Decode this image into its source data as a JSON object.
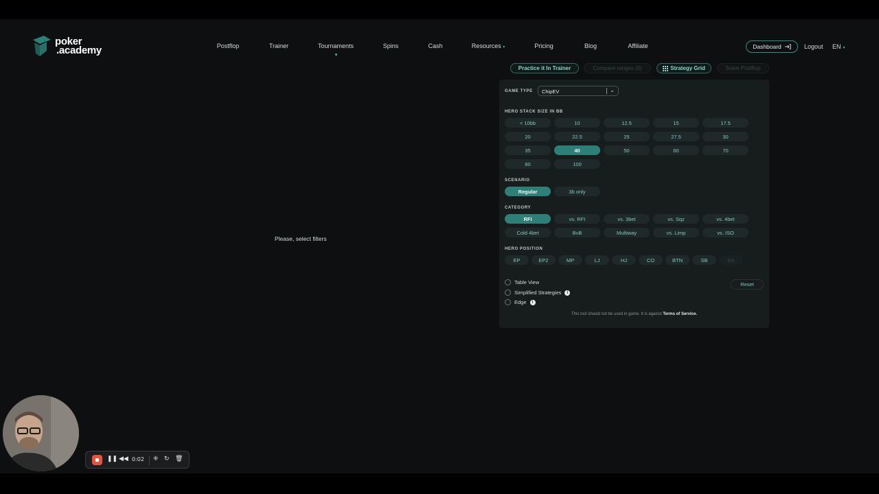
{
  "logo": {
    "line1": "poker",
    "line2": ".academy"
  },
  "nav": {
    "items": [
      {
        "label": "Postflop"
      },
      {
        "label": "Trainer"
      },
      {
        "label": "Tournaments"
      },
      {
        "label": "Spins"
      },
      {
        "label": "Cash"
      },
      {
        "label": "Resources"
      },
      {
        "label": "Pricing"
      },
      {
        "label": "Blog"
      },
      {
        "label": "Affiliate"
      }
    ],
    "resources_caret": "▾",
    "dashboard_label": "Dashboard",
    "logout_label": "Logout",
    "language": "EN",
    "language_caret": "▾"
  },
  "actions": {
    "practice": "Practice it In Trainer",
    "compare": "Compare ranges (0)",
    "strategy_grid": "Strategy Grid",
    "solve_postflop": "Solve Postflop"
  },
  "filters": {
    "game_type_label": "GAME TYPE",
    "game_type_value": "ChipEV",
    "stack_label": "HERO STACK SIZE IN BB",
    "stacks": [
      "< 10bb",
      "10",
      "12.5",
      "15",
      "17.5",
      "20",
      "22.5",
      "25",
      "27.5",
      "30",
      "35",
      "40",
      "50",
      "60",
      "70",
      "80",
      "100"
    ],
    "stack_selected": "40",
    "scenario_label": "SCENARIO",
    "scenarios": [
      "Regular",
      "3b only"
    ],
    "scenario_selected": "Regular",
    "category_label": "CATEGORY",
    "categories": [
      "RFI",
      "vs. RFI",
      "vs. 3bet",
      "vs. Sqz",
      "vs. 4bet",
      "Cold 4bet",
      "BvB",
      "Multiway",
      "vs. Limp",
      "vs. ISO"
    ],
    "category_selected": "RFI",
    "position_label": "HERO POSITION",
    "positions": [
      "EP",
      "EP2",
      "MP",
      "LJ",
      "HJ",
      "CO",
      "BTN",
      "SB",
      "BB"
    ],
    "position_disabled": "BB",
    "options": {
      "table_view": "Table View",
      "simplified": "Simplified Strategies",
      "edge": "Edge"
    },
    "reset_label": "Reset",
    "disclaimer_prefix": "This tool should not be used in game. It is against ",
    "disclaimer_link": "Terms of Service."
  },
  "main": {
    "empty_message": "Please, select filters"
  },
  "recorder": {
    "time": "0:02"
  },
  "colors": {
    "accent": "#3fb3a6",
    "selected_chip": "#2e7f78",
    "record": "#e5533d"
  }
}
